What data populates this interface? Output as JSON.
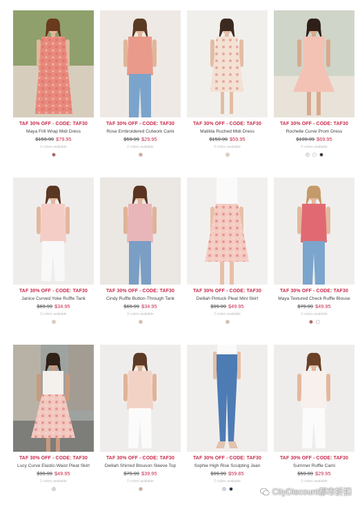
{
  "products": [
    {
      "promo": "TAF 30% OFF - CODE: TAF30",
      "name": "Maya Frill Wrap Midi Dress",
      "was": "$159.99",
      "now": "$79.95",
      "colors_text": "2 colors available",
      "swatches": [
        "#b35a52"
      ],
      "image": {
        "bg": "#c9cbc0",
        "skin": "#e2b79d",
        "hair": "#6a3a1e",
        "top": "#e88a7c",
        "bottom": "#e88a7c",
        "shoes": "#e9c8b5",
        "kind": "long-dress"
      }
    },
    {
      "promo": "TAF 30% OFF - CODE: TAF30",
      "name": "Rose Embroidered Cutwork Cami",
      "was": "$59.99",
      "now": "$29.95",
      "colors_text": "2 colors available",
      "swatches": [
        "#e0a08e"
      ],
      "image": {
        "bg": "#efe9e5",
        "skin": "#e1b59a",
        "hair": "#5b3a23",
        "top": "#e99a8a",
        "bottom": "#7aa4cc",
        "shoes": "#f2efec",
        "kind": "top-jeans"
      }
    },
    {
      "promo": "TAF 30% OFF - CODE: TAF30",
      "name": "Matilda Ruched Midi Dress",
      "was": "$159.99",
      "now": "$59.95",
      "colors_text": "3 colors available",
      "swatches": [
        "#e8ceb0"
      ],
      "image": {
        "bg": "#f1efec",
        "skin": "#e3bca3",
        "hair": "#3c2a20",
        "top": "#f3e1d2",
        "bottom": "#f3e1d2",
        "shoes": "#e5c9b6",
        "kind": "midi-dress"
      }
    },
    {
      "promo": "TAF 30% OFF - CODE: TAF30",
      "name": "Rochelle Curve Prom Dress",
      "was": "$199.99",
      "now": "$69.95",
      "colors_text": "3 colors available",
      "swatches": [
        "#f0e6d8",
        "#ffffff",
        "#3a2a2e"
      ],
      "image": {
        "bg": "#d9d3c8",
        "skin": "#d9a98c",
        "hair": "#2e2019",
        "top": "#f4c2b4",
        "bottom": "#f4c2b4",
        "shoes": "#d9a98c",
        "kind": "prom"
      }
    },
    {
      "promo": "TAF 30% OFF - CODE: TAF30",
      "name": "Janice Curved Yoke Ruffle Tank",
      "was": "$69.99",
      "now": "$34.95",
      "colors_text": "3 colors available",
      "swatches": [
        "#f0c8b8"
      ],
      "image": {
        "bg": "#efedeb",
        "skin": "#e3b79c",
        "hair": "#5a3722",
        "top": "#f4cdc6",
        "bottom": "#f8f8f8",
        "shoes": "#f1f1f1",
        "kind": "top-pants"
      }
    },
    {
      "promo": "TAF 30% OFF - CODE: TAF30",
      "name": "Cindy Ruffle Button-Through Tank",
      "was": "$69.99",
      "now": "$34.95",
      "colors_text": "3 colors available",
      "swatches": [
        "#e9b6ad"
      ],
      "image": {
        "bg": "#ebe7e3",
        "skin": "#dfb396",
        "hair": "#5a3420",
        "top": "#e8b5b8",
        "bottom": "#7a9ec4",
        "shoes": "#f0ece8",
        "kind": "top-jeans"
      }
    },
    {
      "promo": "TAF 30% OFF - CODE: TAF30",
      "name": "Delilah Pintuck Pleat Mini Skirt",
      "was": "$99.99",
      "now": "$49.95",
      "colors_text": "2 colors available",
      "swatches": [
        "#e8b8a6"
      ],
      "image": {
        "bg": "#f2f0ee",
        "skin": "#e6c0a8",
        "hair": "#e6c0a8",
        "top": "#fafafa",
        "bottom": "#f4cbc1",
        "shoes": "#e6c0a8",
        "kind": "skirt"
      }
    },
    {
      "promo": "TAF 30% OFF - CODE: TAF30",
      "name": "Maya Textured Check Ruffle Blouse",
      "was": "$79.99",
      "now": "$49.95",
      "colors_text": "2 colors available",
      "swatches": [
        "#c05a5a",
        "#ffffff"
      ],
      "image": {
        "bg": "#f0eeec",
        "skin": "#e3b99f",
        "hair": "#c59a6a",
        "top": "#e16a72",
        "bottom": "#7ba5cd",
        "shoes": "#f0ece8",
        "kind": "top-jeans"
      }
    },
    {
      "promo": "TAF 30% OFF - CODE: TAF30",
      "name": "Lucy Curve Elastic-Waist Pleat Skirt",
      "was": "$99.99",
      "now": "$49.95",
      "colors_text": "2 colors available",
      "swatches": [
        "#d8d8d8"
      ],
      "image": {
        "bg": "#9ea3a0",
        "skin": "#c99a7e",
        "hair": "#2f2118",
        "top": "#f4f0ec",
        "bottom": "#f2c8bf",
        "shoes": "#caa088",
        "kind": "skirt-street"
      }
    },
    {
      "promo": "TAF 30% OFF - CODE: TAF30",
      "name": "Delilah Shirred Blouson Sleeve Top",
      "was": "$79.99",
      "now": "$39.95",
      "colors_text": "2 colors available",
      "swatches": [
        "#e0a48c"
      ],
      "image": {
        "bg": "#efedeb",
        "skin": "#e0b396",
        "hair": "#5c3a26",
        "top": "#f3d2c6",
        "bottom": "#fbfbfb",
        "shoes": "#f3efe9",
        "kind": "top-pants"
      }
    },
    {
      "promo": "TAF 30% OFF - CODE: TAF30",
      "name": "Sophie High Rise Sculpting Jean",
      "was": "$99.99",
      "now": "$59.85",
      "colors_text": "2 colors available",
      "swatches": [
        "#c8d6e8",
        "#1f2e4a"
      ],
      "image": {
        "bg": "#f0eeec",
        "skin": "#e4bfa6",
        "hair": "#e4bfa6",
        "top": "#fafafa",
        "bottom": "#4d7bb4",
        "shoes": "#e2c3b0",
        "kind": "jeans"
      }
    },
    {
      "promo": "TAF 30% OFF - CODE: TAF30",
      "name": "Summer Ruffle Cami",
      "was": "$59.99",
      "now": "$29.95",
      "colors_text": "3 colors available",
      "swatches": [],
      "image": {
        "bg": "#efedeb",
        "skin": "#e3b89d",
        "hair": "#6b4127",
        "top": "#f7f0ec",
        "bottom": "#fbfbfb",
        "shoes": "#f0ece8",
        "kind": "top-pants"
      }
    }
  ],
  "watermark": {
    "text": "CityDiscount都市折扣"
  }
}
